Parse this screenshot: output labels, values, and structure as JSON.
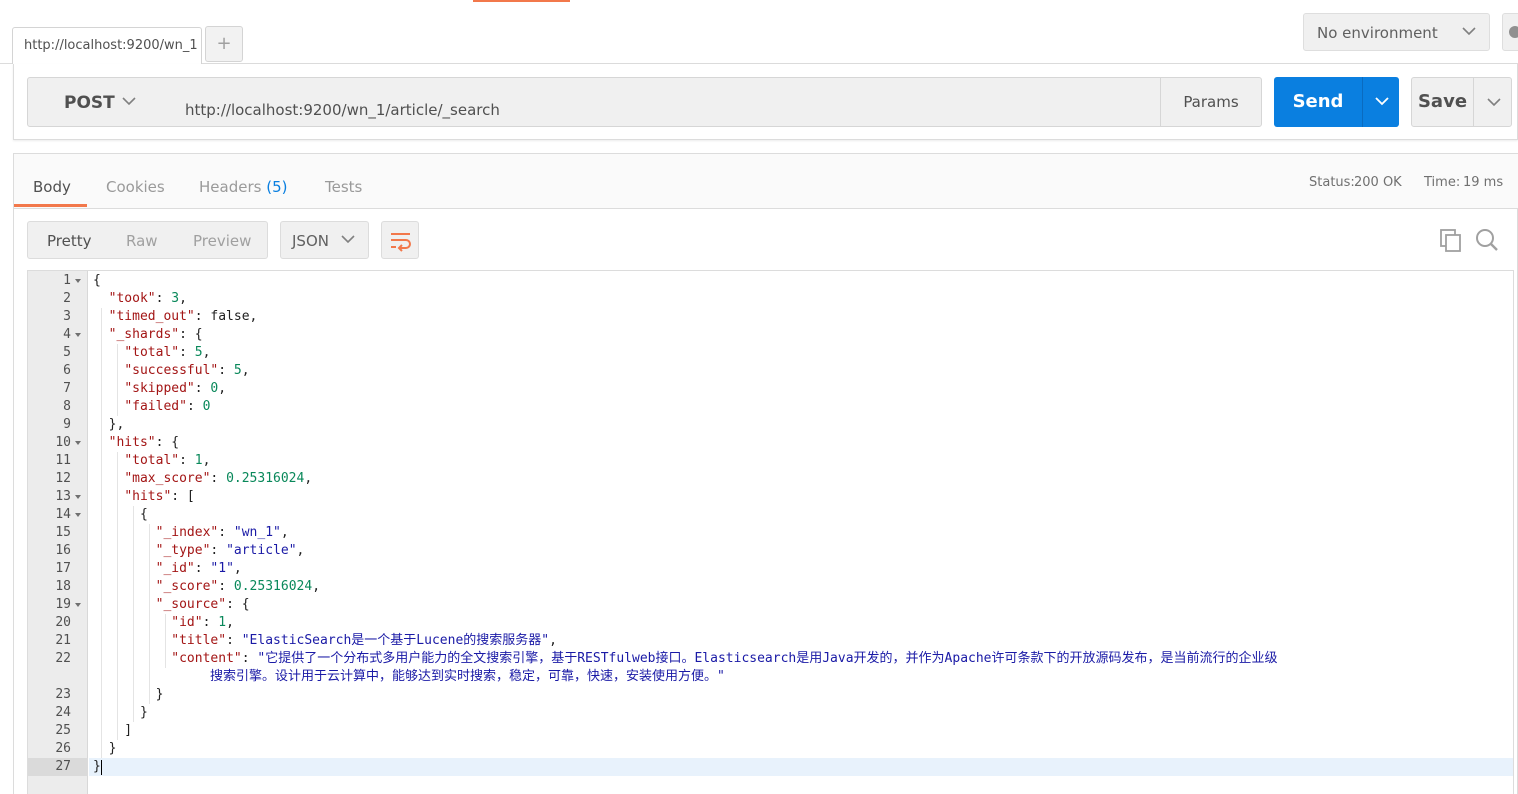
{
  "tabs": {
    "active_tab_label": "http://localhost:9200/wn_1",
    "add_tab_label": "+"
  },
  "environment": {
    "selected": "No environment"
  },
  "request": {
    "method": "POST",
    "url": "http://localhost:9200/wn_1/article/_search",
    "params_label": "Params",
    "send_label": "Send",
    "save_label": "Save"
  },
  "response": {
    "tabs": {
      "body": "Body",
      "cookies": "Cookies",
      "headers": "Headers",
      "headers_count": "(5)",
      "tests": "Tests"
    },
    "status_label": "Status:",
    "status_value": "200 OK",
    "time_label": "Time:",
    "time_value": "19 ms",
    "views": {
      "pretty": "Pretty",
      "raw": "Raw",
      "preview": "Preview"
    },
    "format": "JSON"
  },
  "code": {
    "line_numbers": [
      "1",
      "2",
      "3",
      "4",
      "5",
      "6",
      "7",
      "8",
      "9",
      "10",
      "11",
      "12",
      "13",
      "14",
      "15",
      "16",
      "17",
      "18",
      "19",
      "20",
      "21",
      "22",
      "23",
      "24",
      "25",
      "26",
      "27"
    ],
    "foldable_lines": [
      1,
      4,
      10,
      13,
      14,
      19
    ],
    "lines": [
      [
        [
          "p",
          "{"
        ]
      ],
      [
        [
          "p",
          "  "
        ],
        [
          "k",
          "\"took\""
        ],
        [
          "p",
          ": "
        ],
        [
          "n",
          "3"
        ],
        [
          "p",
          ","
        ]
      ],
      [
        [
          "p",
          "  "
        ],
        [
          "k",
          "\"timed_out\""
        ],
        [
          "p",
          ": false,"
        ]
      ],
      [
        [
          "p",
          "  "
        ],
        [
          "k",
          "\"_shards\""
        ],
        [
          "p",
          ": {"
        ]
      ],
      [
        [
          "p",
          "    "
        ],
        [
          "k",
          "\"total\""
        ],
        [
          "p",
          ": "
        ],
        [
          "n",
          "5"
        ],
        [
          "p",
          ","
        ]
      ],
      [
        [
          "p",
          "    "
        ],
        [
          "k",
          "\"successful\""
        ],
        [
          "p",
          ": "
        ],
        [
          "n",
          "5"
        ],
        [
          "p",
          ","
        ]
      ],
      [
        [
          "p",
          "    "
        ],
        [
          "k",
          "\"skipped\""
        ],
        [
          "p",
          ": "
        ],
        [
          "n",
          "0"
        ],
        [
          "p",
          ","
        ]
      ],
      [
        [
          "p",
          "    "
        ],
        [
          "k",
          "\"failed\""
        ],
        [
          "p",
          ": "
        ],
        [
          "n",
          "0"
        ]
      ],
      [
        [
          "p",
          "  },"
        ]
      ],
      [
        [
          "p",
          "  "
        ],
        [
          "k",
          "\"hits\""
        ],
        [
          "p",
          ": {"
        ]
      ],
      [
        [
          "p",
          "    "
        ],
        [
          "k",
          "\"total\""
        ],
        [
          "p",
          ": "
        ],
        [
          "n",
          "1"
        ],
        [
          "p",
          ","
        ]
      ],
      [
        [
          "p",
          "    "
        ],
        [
          "k",
          "\"max_score\""
        ],
        [
          "p",
          ": "
        ],
        [
          "n",
          "0.25316024"
        ],
        [
          "p",
          ","
        ]
      ],
      [
        [
          "p",
          "    "
        ],
        [
          "k",
          "\"hits\""
        ],
        [
          "p",
          ": ["
        ]
      ],
      [
        [
          "p",
          "      {"
        ]
      ],
      [
        [
          "p",
          "        "
        ],
        [
          "k",
          "\"_index\""
        ],
        [
          "p",
          ": "
        ],
        [
          "s",
          "\"wn_1\""
        ],
        [
          "p",
          ","
        ]
      ],
      [
        [
          "p",
          "        "
        ],
        [
          "k",
          "\"_type\""
        ],
        [
          "p",
          ": "
        ],
        [
          "s",
          "\"article\""
        ],
        [
          "p",
          ","
        ]
      ],
      [
        [
          "p",
          "        "
        ],
        [
          "k",
          "\"_id\""
        ],
        [
          "p",
          ": "
        ],
        [
          "s",
          "\"1\""
        ],
        [
          "p",
          ","
        ]
      ],
      [
        [
          "p",
          "        "
        ],
        [
          "k",
          "\"_score\""
        ],
        [
          "p",
          ": "
        ],
        [
          "n",
          "0.25316024"
        ],
        [
          "p",
          ","
        ]
      ],
      [
        [
          "p",
          "        "
        ],
        [
          "k",
          "\"_source\""
        ],
        [
          "p",
          ": {"
        ]
      ],
      [
        [
          "p",
          "          "
        ],
        [
          "k",
          "\"id\""
        ],
        [
          "p",
          ": "
        ],
        [
          "n",
          "1"
        ],
        [
          "p",
          ","
        ]
      ],
      [
        [
          "p",
          "          "
        ],
        [
          "k",
          "\"title\""
        ],
        [
          "p",
          ": "
        ],
        [
          "s",
          "\"ElasticSearch是一个基于Lucene的搜索服务器\""
        ],
        [
          "p",
          ","
        ]
      ],
      [
        [
          "p",
          "          "
        ],
        [
          "k",
          "\"content\""
        ],
        [
          "p",
          ": "
        ],
        [
          "s",
          "\"它提供了一个分布式多用户能力的全文搜索引擎，基于RESTfulweb接口。Elasticsearch是用Java开发的，并作为Apache许可条款下的开放源码发布，是当前流行的企业级"
        ]
      ],
      [
        [
          "p",
          "        }"
        ]
      ],
      [
        [
          "p",
          "      }"
        ]
      ],
      [
        [
          "p",
          "    ]"
        ]
      ],
      [
        [
          "p",
          "  }"
        ]
      ],
      [
        [
          "p",
          "}"
        ]
      ]
    ],
    "wrapped_continuation": "搜索引擎。设计用于云计算中，能够达到实时搜索，稳定，可靠，快速，安装使用方便。\""
  }
}
